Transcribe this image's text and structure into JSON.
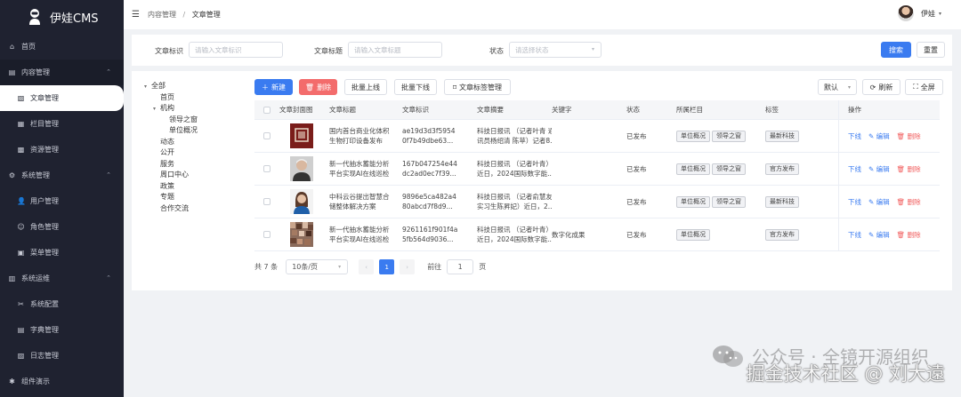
{
  "app": {
    "name": "伊娃CMS"
  },
  "sidebar": {
    "items": [
      {
        "label": "首页",
        "icon": "home-icon",
        "level": 0
      },
      {
        "label": "内容管理",
        "icon": "content-icon",
        "level": 0,
        "expanded": true
      },
      {
        "label": "文章管理",
        "icon": "article-icon",
        "level": 1,
        "active": true
      },
      {
        "label": "栏目管理",
        "icon": "column-icon",
        "level": 1
      },
      {
        "label": "资源管理",
        "icon": "resource-icon",
        "level": 1
      },
      {
        "label": "系统管理",
        "icon": "settings-icon",
        "level": 0,
        "expanded": true
      },
      {
        "label": "用户管理",
        "icon": "user-icon",
        "level": 1
      },
      {
        "label": "角色管理",
        "icon": "role-icon",
        "level": 1
      },
      {
        "label": "菜单管理",
        "icon": "menu-icon",
        "level": 1
      },
      {
        "label": "系统运维",
        "icon": "ops-icon",
        "level": 0,
        "expanded": true
      },
      {
        "label": "系统配置",
        "icon": "config-icon",
        "level": 1
      },
      {
        "label": "字典管理",
        "icon": "dict-icon",
        "level": 1
      },
      {
        "label": "日志管理",
        "icon": "log-icon",
        "level": 1
      },
      {
        "label": "组件演示",
        "icon": "demo-icon",
        "level": 0
      }
    ]
  },
  "header": {
    "breadcrumb": [
      "内容管理",
      "文章管理"
    ],
    "user": "伊娃"
  },
  "search": {
    "fields": [
      {
        "label": "文章标识",
        "placeholder": "请输入文章标识"
      },
      {
        "label": "文章标题",
        "placeholder": "请输入文章标题"
      },
      {
        "label": "状态",
        "placeholder": "请选择状态"
      }
    ],
    "search_label": "搜索",
    "reset_label": "重置"
  },
  "tree": [
    {
      "label": "全部",
      "depth": 0,
      "arrow": "▾"
    },
    {
      "label": "首页",
      "depth": 1
    },
    {
      "label": "机构",
      "depth": 1,
      "arrow": "▾"
    },
    {
      "label": "领导之窗",
      "depth": 2
    },
    {
      "label": "单位概况",
      "depth": 2
    },
    {
      "label": "动态",
      "depth": 1
    },
    {
      "label": "公开",
      "depth": 1
    },
    {
      "label": "服务",
      "depth": 1
    },
    {
      "label": "周口中心",
      "depth": 1
    },
    {
      "label": "政策",
      "depth": 1
    },
    {
      "label": "专题",
      "depth": 1
    },
    {
      "label": "合作交流",
      "depth": 1
    }
  ],
  "toolbar": {
    "add": "新建",
    "delete": "删除",
    "batch_online": "批量上线",
    "batch_offline": "批量下线",
    "tag_manage": "文章标签管理",
    "sort": "默认",
    "refresh": "刷新",
    "fullscreen": "全屏"
  },
  "table": {
    "columns": [
      "文章封面图",
      "文章标题",
      "文章标识",
      "文章摘要",
      "关键字",
      "状态",
      "所属栏目",
      "标签",
      "操作"
    ],
    "rows": [
      {
        "title": [
          "国内首台商业化体积",
          "生物打印设备发布"
        ],
        "id": [
          "ae19d3d3f5954",
          "0f7b49dbe63..."
        ],
        "summary": [
          "科技日报讯 （记者叶青 通",
          "讯员杨绍清 陈苹）记者8..."
        ],
        "keyword": "",
        "status": "已发布",
        "columns": [
          "单位概况",
          "领导之窗"
        ],
        "tag": "最新科技",
        "thumb": "red-seal"
      },
      {
        "title": [
          "新一代抽水蓄能分析",
          "平台实现AI在线巡检"
        ],
        "id": [
          "167b047254e44",
          "dc2ad0ec7f39..."
        ],
        "summary": [
          "科技日报讯 （记者叶青）",
          "近日，2024国际数字能..."
        ],
        "keyword": "",
        "status": "已发布",
        "columns": [
          "单位概况",
          "领导之窗"
        ],
        "tag": "官方发布",
        "thumb": "portrait-man"
      },
      {
        "title": [
          "中科云谷提出智慧合",
          "储整体解决方案"
        ],
        "id": [
          "9896e5ca482a4",
          "80abcd7f8d9..."
        ],
        "summary": [
          "科技日报讯 （记者俞慧友",
          "实习生陈昇妃）近日，2..."
        ],
        "keyword": "",
        "status": "已发布",
        "columns": [
          "单位概况",
          "领导之窗"
        ],
        "tag": "最新科技",
        "thumb": "portrait-woman"
      },
      {
        "title": [
          "新一代抽水蓄能分析",
          "平台实现AI在线巡检"
        ],
        "id": [
          "9261161f901f4a",
          "5fb564d9036..."
        ],
        "summary": [
          "科技日报讯 （记者叶青）",
          "近日，2024国际数字能..."
        ],
        "keyword": "数字化成果",
        "status": "已发布",
        "columns": [
          "单位概况"
        ],
        "tag": "官方发布",
        "thumb": "mosaic"
      }
    ],
    "ops": {
      "offline": "下线",
      "edit": "编辑",
      "delete": "删除"
    }
  },
  "pager": {
    "total": "共 7 条",
    "size": "10条/页",
    "current": "1",
    "goto_label": "前往",
    "goto_value": "1",
    "page_suffix": "页"
  },
  "watermark": {
    "line1": "公众号 · 全镜开源组织",
    "line2": "掘金技术社区 @ 刘大遠"
  },
  "colors": {
    "primary": "#3a7bf0",
    "danger": "#f36c6c",
    "sidebar": "#1f2230"
  }
}
